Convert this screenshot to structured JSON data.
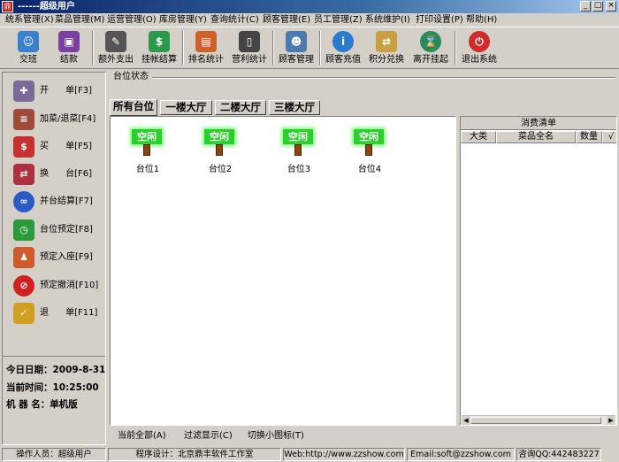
{
  "window": {
    "title": "------超级用户",
    "app_icon": "鼎"
  },
  "window_buttons": {
    "min": "_",
    "max": "□",
    "close": "×"
  },
  "menu": [
    "统系管理(X)",
    "菜品管理(M)",
    "运营管理(O)",
    "库房管理(Y)",
    "查询统计(C)",
    "顾客管理(E)",
    "员工管理(Z)",
    "系统维护(I)",
    "打印设置(P)",
    "帮助(H)"
  ],
  "toolbar": [
    {
      "label": "交班",
      "icon": "people-icon",
      "glyph": "☺"
    },
    {
      "label": "结款",
      "icon": "cash-register-icon",
      "glyph": "▣"
    },
    {
      "label": "额外支出",
      "icon": "pen-icon",
      "glyph": "✎"
    },
    {
      "label": "挂帐结算",
      "icon": "card-icon",
      "glyph": "$"
    },
    {
      "label": "排名统计",
      "icon": "chart-icon",
      "glyph": "▤"
    },
    {
      "label": "营利统计",
      "icon": "phone-icon",
      "glyph": "▯"
    },
    {
      "label": "顾客管理",
      "icon": "customer-icon",
      "glyph": "☻"
    },
    {
      "label": "顾客充值",
      "icon": "info-icon",
      "glyph": "i"
    },
    {
      "label": "积分兑换",
      "icon": "exchange-icon",
      "glyph": "⇄"
    },
    {
      "label": "离开挂起",
      "icon": "hourglass-icon",
      "glyph": "⌛"
    },
    {
      "label": "退出系统",
      "icon": "exit-icon",
      "glyph": "⏻"
    }
  ],
  "sidebar": [
    {
      "label": "开      单[F3]",
      "icon": "open-order-icon",
      "glyph": "✚"
    },
    {
      "label": "加菜/退菜[F4]",
      "icon": "add-dish-icon",
      "glyph": "≡"
    },
    {
      "label": "买      单[F5]",
      "icon": "checkout-icon",
      "glyph": "$"
    },
    {
      "label": "换      台[F6]",
      "icon": "swap-table-icon",
      "glyph": "⇄"
    },
    {
      "label": "并台结算[F7]",
      "icon": "merge-table-icon",
      "glyph": "∞"
    },
    {
      "label": "台位预定[F8]",
      "icon": "reserve-icon",
      "glyph": "◷"
    },
    {
      "label": "预定入座[F9]",
      "icon": "seat-in-icon",
      "glyph": "♟"
    },
    {
      "label": "预定撤消[F10]",
      "icon": "cancel-reserve-icon",
      "glyph": "⊘"
    },
    {
      "label": "退      单[F11]",
      "icon": "return-order-icon",
      "glyph": "✓"
    }
  ],
  "info": {
    "date": "今日日期：2009-8-31",
    "time": "当前时间：10:25:00",
    "machine": "机  器  名：单机版"
  },
  "group_title": "台位状态",
  "tabs": [
    "所有台位",
    "一楼大厅",
    "二楼大厅",
    "三楼大厅"
  ],
  "tables": [
    {
      "status": "空闲",
      "name": "台位1"
    },
    {
      "status": "空闲",
      "name": "台位2"
    },
    {
      "status": "空闲",
      "name": "台位3"
    },
    {
      "status": "空闲",
      "name": "台位4"
    }
  ],
  "consumption": {
    "title": "消费清单",
    "columns": [
      "大类",
      "菜品全名",
      "数量",
      "√"
    ]
  },
  "bottom_links": [
    "当前全部(A)",
    "过滤显示(C)",
    "切换小图标(T)"
  ],
  "status": [
    "操作人员：超级用户",
    "程序设计：北京鼎丰软件工作室",
    "Web:http://www.zzshow.com",
    "Email:soft@zzshow.com",
    "咨询QQ:442483227"
  ],
  "colors": {
    "face": "#d4d0c8",
    "title_start": "#0a246a",
    "status_free": "#2bd12b"
  }
}
